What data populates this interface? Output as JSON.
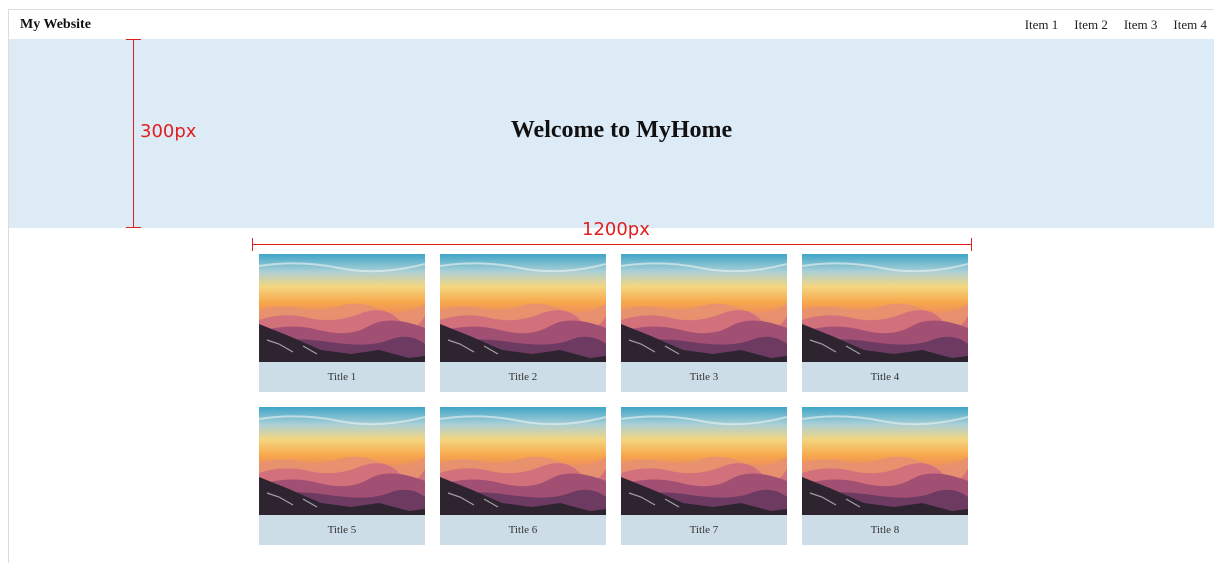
{
  "navbar": {
    "brand": "My Website",
    "items": [
      {
        "label": "Item 1"
      },
      {
        "label": "Item 2"
      },
      {
        "label": "Item 3"
      },
      {
        "label": "Item 4"
      }
    ]
  },
  "hero": {
    "title": "Welcome to MyHome"
  },
  "annotations": {
    "height_label": "300px",
    "width_label": "1200px",
    "color": "#e02020"
  },
  "cards": [
    {
      "title": "Title 1",
      "image": "sunset-mountains-image"
    },
    {
      "title": "Title 2",
      "image": "sunset-mountains-image"
    },
    {
      "title": "Title 3",
      "image": "sunset-mountains-image"
    },
    {
      "title": "Title 4",
      "image": "sunset-mountains-image"
    },
    {
      "title": "Title 5",
      "image": "sunset-mountains-image"
    },
    {
      "title": "Title 6",
      "image": "sunset-mountains-image"
    },
    {
      "title": "Title 7",
      "image": "sunset-mountains-image"
    },
    {
      "title": "Title 8",
      "image": "sunset-mountains-image"
    }
  ],
  "colors": {
    "hero_bg": "#ddebf7",
    "caption_bg": "#cddde8"
  }
}
